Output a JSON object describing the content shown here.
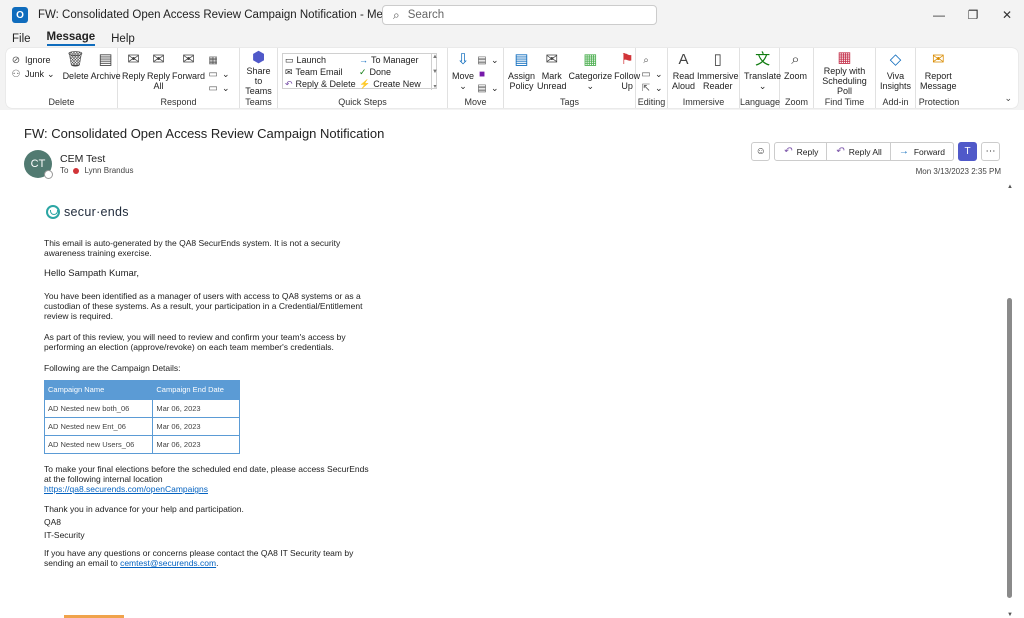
{
  "window": {
    "title": "FW: Consolidated Open Access Review Campaign Notification  -  Message (HTML)",
    "search_placeholder": "Search",
    "controls": [
      "—",
      "❐",
      "✕"
    ]
  },
  "menu": {
    "tabs": [
      "File",
      "Message",
      "Help"
    ],
    "active": "Message"
  },
  "ribbon": {
    "groups": {
      "delete": {
        "label": "Delete",
        "ignore": "Ignore",
        "junk": "Junk",
        "delete": "Delete",
        "archive": "Archive"
      },
      "respond": {
        "label": "Respond",
        "reply": "Reply",
        "reply_all_1": "Reply",
        "reply_all_2": "All",
        "forward": "Forward"
      },
      "teams": {
        "label": "Teams",
        "share_1": "Share to",
        "share_2": "Teams"
      },
      "quick_steps": {
        "label": "Quick Steps",
        "items": [
          "Launch",
          "To Manager",
          "Team Email",
          "Done",
          "Reply & Delete",
          "Create New"
        ]
      },
      "move": {
        "label": "Move",
        "move": "Move"
      },
      "tags": {
        "label": "Tags",
        "assign_1": "Assign",
        "assign_2": "Policy",
        "mark_1": "Mark",
        "mark_2": "Unread",
        "categorize": "Categorize",
        "follow_1": "Follow",
        "follow_2": "Up"
      },
      "editing": {
        "label": "Editing"
      },
      "immersive": {
        "label": "Immersive",
        "read_1": "Read",
        "read_2": "Aloud",
        "imm_1": "Immersive",
        "imm_2": "Reader"
      },
      "language": {
        "label": "Language",
        "translate": "Translate"
      },
      "zoom": {
        "label": "Zoom",
        "zoom": "Zoom"
      },
      "find_time": {
        "label": "Find Time",
        "reply_1": "Reply with",
        "reply_2": "Scheduling Poll"
      },
      "addin": {
        "label": "Add-in",
        "viva_1": "Viva",
        "viva_2": "Insights"
      },
      "protection": {
        "label": "Protection",
        "report_1": "Report",
        "report_2": "Message"
      }
    }
  },
  "message": {
    "subject": "FW: Consolidated Open Access Review Campaign Notification",
    "avatar_initials": "CT",
    "sender": "CEM Test",
    "to_label": "To",
    "recipient": "Lynn Brandus",
    "date": "Mon 3/13/2023 2:35 PM",
    "actions": {
      "reply": "Reply",
      "reply_all": "Reply All",
      "forward": "Forward"
    }
  },
  "body": {
    "logo_text": "secur·ends",
    "p1": "This email is auto-generated by the QA8 SecurEnds system. It is not a security awareness training exercise.",
    "greeting": "Hello Sampath Kumar,",
    "p2": "You have been identified as a manager of users with access to QA8 systems or as a custodian of these systems. As a result, your participation in a Credential/Entitlement review is required.",
    "p3": "As part of this review, you will need to review and confirm your team's access by performing an election (approve/revoke) on each team member's credentials.",
    "p4": "Following are the Campaign Details:",
    "table": {
      "headers": [
        "Campaign Name",
        "Campaign End Date"
      ],
      "rows": [
        [
          "AD Nested new both_06",
          "Mar 06, 2023"
        ],
        [
          "AD Nested new Ent_06",
          "Mar 06, 2023"
        ],
        [
          "AD Nested new Users_06",
          "Mar 06, 2023"
        ]
      ]
    },
    "p5": "To make your final elections before the scheduled end date, please access SecurEnds at the following internal location",
    "link": "https://qa8.securends.com/openCampaigns",
    "p6": "Thank you in advance for your help and participation.",
    "sig1": "QA8",
    "sig2": "IT-Security",
    "p7_pre": "If you have any questions or concerns please contact the QA8 IT Security team by sending an email to ",
    "email": "cemtest@securends.com",
    "p7_post": "."
  }
}
